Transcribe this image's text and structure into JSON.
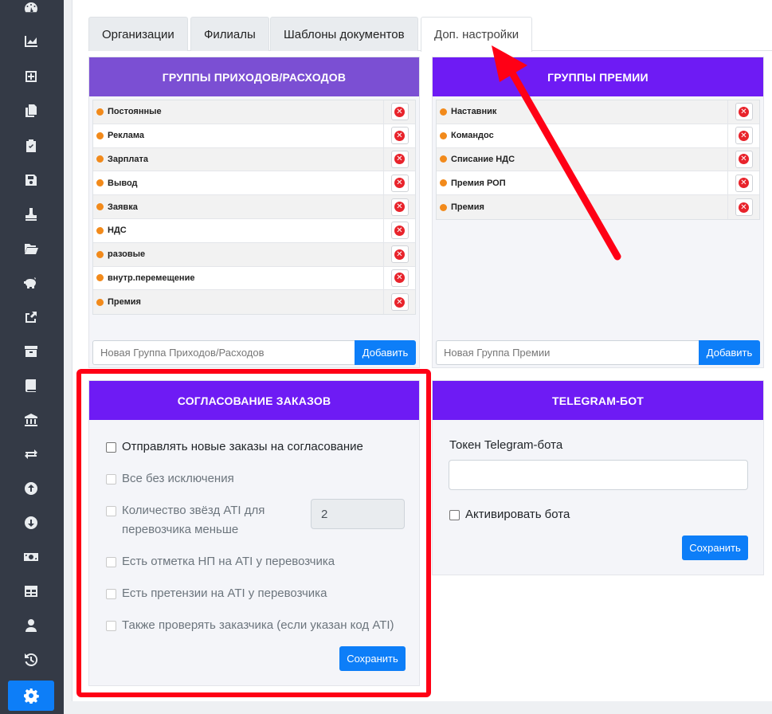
{
  "sidebar": {
    "icons": [
      "dashboard-icon",
      "chart-icon",
      "add-icon",
      "copy-icon",
      "clipboard-check-icon",
      "save-icon",
      "stamp-icon",
      "folder-open-icon",
      "piggy-bank-icon",
      "share-icon",
      "archive-icon",
      "book-icon",
      "bank-icon",
      "exchange-icon",
      "arrow-up-circle-icon",
      "arrow-down-circle-icon",
      "money-icon",
      "table-icon",
      "user-icon",
      "history-icon",
      "gear-icon"
    ],
    "active": "gear-icon"
  },
  "tabs": [
    {
      "label": "Организации",
      "active": false
    },
    {
      "label": "Филиалы",
      "active": false
    },
    {
      "label": "Шаблоны документов",
      "active": false
    },
    {
      "label": "Доп. настройки",
      "active": true
    }
  ],
  "income_groups": {
    "title": "ГРУППЫ ПРИХОДОВ/РАСХОДОВ",
    "items": [
      "Постоянные",
      "Реклама",
      "Зарплата",
      "Вывод",
      "Заявка",
      "НДС",
      "разовые",
      "внутр.перемещение",
      "Премия"
    ],
    "placeholder": "Новая Группа Приходов/Расходов",
    "add_label": "Добавить"
  },
  "bonus_groups": {
    "title": "ГРУППЫ ПРЕМИИ",
    "items": [
      "Наставник",
      "Командос",
      "Списание НДС",
      "Премия РОП",
      "Премия"
    ],
    "placeholder": "Новая Группа Премии",
    "add_label": "Добавить"
  },
  "approval": {
    "title": "СОГЛАСОВАНИЕ ЗАКАЗОВ",
    "send_label": "Отправлять новые заказы на согласование",
    "all_label": "Все без исключения",
    "stars_label_1": "Количество звёзд ATI для",
    "stars_label_2": "перевозчика меньше",
    "stars_value": "2",
    "np_label": "Есть отметка НП на ATI у перевозчика",
    "claims_label": "Есть претензии на ATI у перевозчика",
    "customer_label": "Также проверять заказчика (если указан код ATI)",
    "save_label": "Сохранить"
  },
  "telegram": {
    "title": "TELEGRAM-БОТ",
    "token_label": "Токен Telegram-бота",
    "token_value": "",
    "activate_label": "Активировать бота",
    "save_label": "Сохранить"
  },
  "colors": {
    "sidebar_bg": "#343a46",
    "accent": "#0d7ef8",
    "header_purple_1": "#7b4fd3",
    "header_purple_2": "#6e1bf4",
    "annotation_red": "#ff0015",
    "group_dot": "#f28a1b"
  }
}
